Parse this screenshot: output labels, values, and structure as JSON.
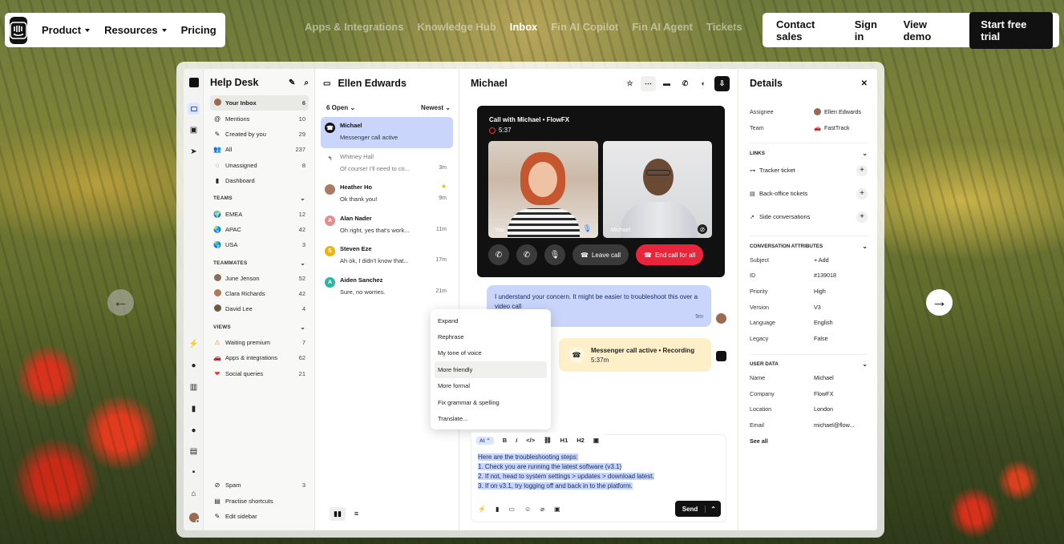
{
  "nav": {
    "left": [
      {
        "label": "Product",
        "caret": true
      },
      {
        "label": "Resources",
        "caret": true
      },
      {
        "label": "Pricing",
        "caret": false
      }
    ],
    "middle": [
      "Apps & Integrations",
      "Knowledge Hub",
      "Inbox",
      "Fin AI Copilot",
      "Fin AI Agent",
      "Tickets"
    ],
    "middle_active": "Inbox",
    "right": {
      "contact": "Contact sales",
      "signin": "Sign in",
      "demo": "View demo",
      "cta": "Start free trial"
    }
  },
  "sidebar": {
    "title": "Help Desk",
    "items": [
      {
        "icon": "avatar",
        "label": "Your Inbox",
        "count": "6"
      },
      {
        "icon": "@",
        "label": "Mentions",
        "count": "10"
      },
      {
        "icon": "✎",
        "label": "Created by you",
        "count": "29"
      },
      {
        "icon": "👥",
        "label": "All",
        "count": "237"
      },
      {
        "icon": "◌",
        "label": "Unassigned",
        "count": "8"
      },
      {
        "icon": "▮",
        "label": "Dashboard",
        "count": ""
      }
    ],
    "teams_title": "TEAMS",
    "teams": [
      {
        "label": "EMEA",
        "count": "12"
      },
      {
        "label": "APAC",
        "count": "42"
      },
      {
        "label": "USA",
        "count": "3"
      }
    ],
    "teammates_title": "TEAMMATES",
    "teammates": [
      {
        "label": "June Jenson",
        "count": "52"
      },
      {
        "label": "Clara Richards",
        "count": "42"
      },
      {
        "label": "David Lee",
        "count": "4"
      }
    ],
    "views_title": "VIEWS",
    "views": [
      {
        "icon": "⚠",
        "label": "Waiting premium",
        "count": "7"
      },
      {
        "icon": "🚗",
        "label": "Apps & integrations",
        "count": "62"
      },
      {
        "icon": "❤",
        "label": "Social queries",
        "count": "21"
      }
    ],
    "bottom": [
      {
        "icon": "⊘",
        "label": "Spam",
        "count": "3"
      },
      {
        "icon": "▤",
        "label": "Practise shortcuts",
        "count": ""
      },
      {
        "icon": "✎",
        "label": "Edit sidebar",
        "count": ""
      }
    ]
  },
  "list": {
    "title": "Ellen Edwards",
    "filter": "6 Open",
    "sort": "Newest",
    "conversations": [
      {
        "name": "Michael",
        "message": "Messenger call active",
        "time": "",
        "color": "#111",
        "initial": "☎"
      },
      {
        "name": "Whitney Hall",
        "message": "Of course! I'll need to co...",
        "time": "3m",
        "color": "#888",
        "initial": "↰"
      },
      {
        "name": "Heather Ho",
        "message": "Ok thank you!",
        "time": "9m",
        "color": "#a87b64",
        "initial": ""
      },
      {
        "name": "Alan Nader",
        "message": "Oh right, yes that's work...",
        "time": "11m",
        "color": "#e58b8b",
        "initial": "A"
      },
      {
        "name": "Steven Eze",
        "message": "Ah ok, I didn't know that...",
        "time": "17m",
        "color": "#f0b400",
        "initial": "S"
      },
      {
        "name": "Aiden Sanchez",
        "message": "Sure, no worries.",
        "time": "21m",
        "color": "#2bb5a5",
        "initial": "A"
      }
    ]
  },
  "conversation": {
    "title": "Michael",
    "call_title": "Call with Michael • FlowFX",
    "call_time": "5:37",
    "video_a_label": "You",
    "video_b_label": "Michael",
    "leave": "Leave call",
    "end": "End call for all",
    "message": "I understand your concern. It might be easier to troubleshoot this over a video call",
    "message_time": "9m",
    "banner_title": "Messenger call active • Recording",
    "banner_time": "5:37m",
    "menu": [
      "Expand",
      "Rephrase",
      "My tone of voice",
      "More friendly",
      "More formal",
      "Fix grammar & spelling",
      "Translate..."
    ],
    "menu_highlight": "More friendly",
    "format": {
      "ai": "AI",
      "b": "B",
      "i": "i",
      "code": "</>",
      "link": "⛓",
      "h1": "H1",
      "h2": "H2"
    },
    "composer_lines": [
      "Here are the troubleshooting steps:",
      "1. Check you are running the latest software (v3.1)",
      "2. If not, head to system settings > updates > download latest.",
      "3. If on v3.1, try logging off and back in to the platform."
    ],
    "send": "Send"
  },
  "details": {
    "title": "Details",
    "assignee_label": "Assignee",
    "assignee": "Ellen Edwards",
    "team_label": "Team",
    "team": "FastTrack",
    "links_title": "LINKS",
    "links": [
      "Tracker ticket",
      "Back-office tickets",
      "Side conversations"
    ],
    "attrs_title": "CONVERSATION ATTRIBUTES",
    "attrs": [
      {
        "k": "Subject",
        "v": "+ Add"
      },
      {
        "k": "ID",
        "v": "#139018"
      },
      {
        "k": "Priority",
        "v": "High"
      },
      {
        "k": "Version",
        "v": "V3"
      },
      {
        "k": "Language",
        "v": "English"
      },
      {
        "k": "Legacy",
        "v": "False"
      }
    ],
    "user_title": "USER DATA",
    "user": [
      {
        "k": "Name",
        "v": "Michael"
      },
      {
        "k": "Company",
        "v": "FlowFX"
      },
      {
        "k": "Location",
        "v": "London"
      },
      {
        "k": "Email",
        "v": "michael@flow..."
      }
    ],
    "see_all": "See all"
  },
  "colors": {
    "accent": "#c9d5fb",
    "brand": "#111111",
    "danger": "#e8253a",
    "banner": "#fdf0c8"
  }
}
